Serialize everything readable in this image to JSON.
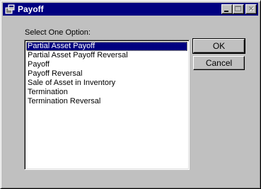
{
  "window": {
    "title": "Payoff",
    "icon": "app-icon"
  },
  "titlebar_buttons": [
    {
      "name": "minimize",
      "icon": "minimize-icon"
    },
    {
      "name": "maximize",
      "icon": "maximize-icon",
      "disabled": true
    },
    {
      "name": "close",
      "icon": "close-icon",
      "disabled": true
    }
  ],
  "dialog": {
    "prompt": "Select One Option:",
    "options": [
      "Partial Asset Payoff",
      "Partial Asset Payoff Reversal",
      "Payoff",
      "Payoff Reversal",
      "Sale of Asset in Inventory",
      "Termination",
      "Termination Reversal"
    ],
    "selected_option": "Partial Asset Payoff",
    "ok_label": "OK",
    "cancel_label": "Cancel"
  },
  "colors": {
    "titlebar": "#000080",
    "selection": "#000080",
    "face": "#c0c0c0"
  }
}
